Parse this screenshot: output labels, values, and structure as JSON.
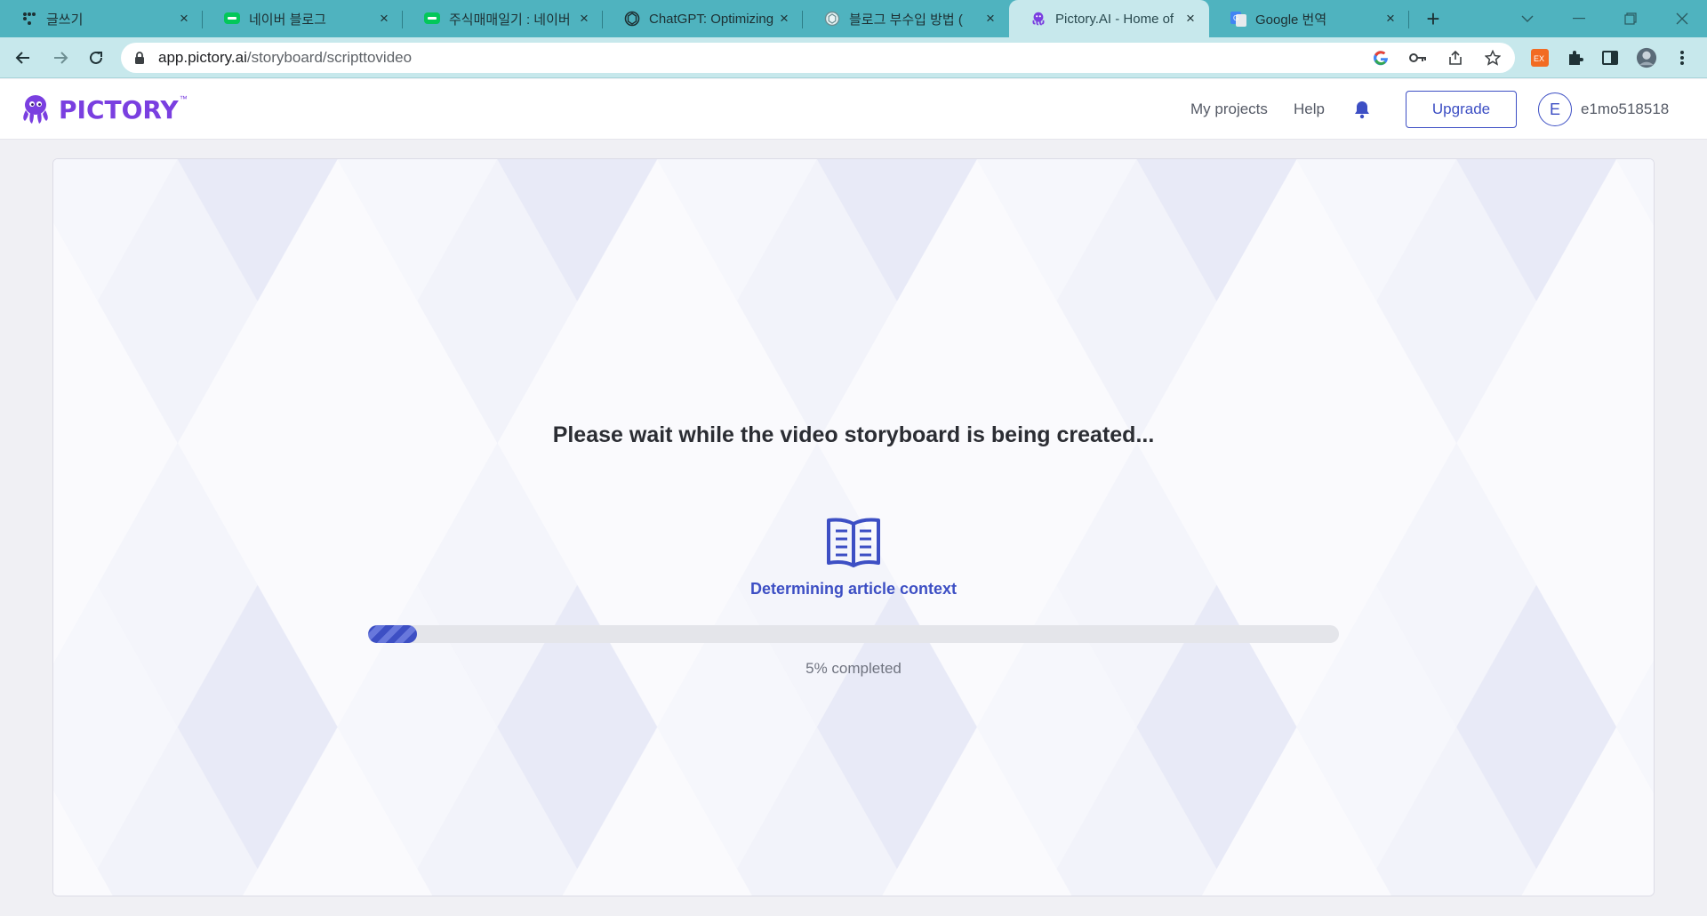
{
  "browser": {
    "tabs": [
      {
        "title": "글쓰기",
        "icon": "dots-grid-icon"
      },
      {
        "title": "네이버 블로그",
        "icon": "naver-blog-icon"
      },
      {
        "title": "주식매매일기 : 네이버",
        "icon": "naver-blog-icon"
      },
      {
        "title": "ChatGPT: Optimizing",
        "icon": "openai-icon"
      },
      {
        "title": "블로그 부수입 방법 (",
        "icon": "openai-icon"
      },
      {
        "title": "Pictory.AI - Home of",
        "icon": "pictory-icon",
        "active": true
      },
      {
        "title": "Google 번역",
        "icon": "google-translate-icon"
      }
    ],
    "new_tab_symbol": "+",
    "close_symbol": "×",
    "address": {
      "host": "app.pictory.ai",
      "path": "/storyboard/scripttovideo"
    },
    "ext_badge": "EX"
  },
  "header": {
    "logo_text": "PICTORY",
    "logo_tm": "™",
    "nav": {
      "my_projects": "My projects",
      "help": "Help"
    },
    "upgrade_label": "Upgrade",
    "avatar_initial": "E",
    "username": "e1mo518518"
  },
  "main": {
    "headline": "Please wait while the video storyboard is being created...",
    "step_label": "Determining article context",
    "progress_percent": 5,
    "progress_text": "5% completed"
  },
  "colors": {
    "brand_purple": "#7a3fe0",
    "accent_blue": "#3d4fc4",
    "tabstrip": "#4fb3bf",
    "toolbar": "#c7e8ec"
  }
}
